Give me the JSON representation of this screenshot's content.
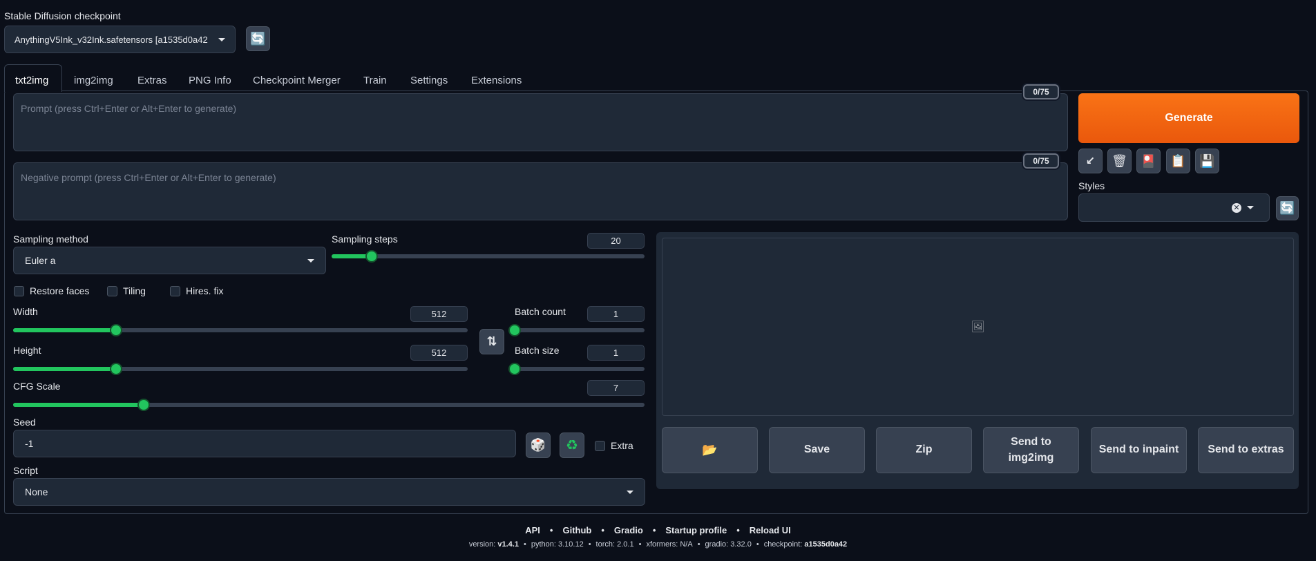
{
  "checkpoint": {
    "label": "Stable Diffusion checkpoint",
    "value": "AnythingV5Ink_v32Ink.safetensors [a1535d0a42"
  },
  "tabs": [
    "txt2img",
    "img2img",
    "Extras",
    "PNG Info",
    "Checkpoint Merger",
    "Train",
    "Settings",
    "Extensions"
  ],
  "prompt": {
    "placeholder": "Prompt (press Ctrl+Enter or Alt+Enter to generate)",
    "counter": "0/75"
  },
  "negative_prompt": {
    "placeholder": "Negative prompt (press Ctrl+Enter or Alt+Enter to generate)",
    "counter": "0/75"
  },
  "generate_label": "Generate",
  "tool_icons": {
    "read": "↙",
    "trash": "🗑",
    "style": "🎴",
    "clipboard": "📋",
    "save": "💾",
    "refresh": "🔄"
  },
  "styles_label": "Styles",
  "sampling": {
    "method_label": "Sampling method",
    "method_value": "Euler a",
    "steps_label": "Sampling steps",
    "steps_value": "20",
    "steps_min": 1,
    "steps_max": 150
  },
  "checkboxes": {
    "restore_faces": "Restore faces",
    "tiling": "Tiling",
    "hires_fix": "Hires. fix"
  },
  "width": {
    "label": "Width",
    "value": "512",
    "min": 64,
    "max": 2048
  },
  "height": {
    "label": "Height",
    "value": "512",
    "min": 64,
    "max": 2048
  },
  "batch_count": {
    "label": "Batch count",
    "value": "1",
    "min": 1,
    "max": 100
  },
  "batch_size": {
    "label": "Batch size",
    "value": "1",
    "min": 1,
    "max": 8
  },
  "cfg": {
    "label": "CFG Scale",
    "value": "7",
    "min": 1,
    "max": 30
  },
  "swap_icon": "⇅",
  "seed": {
    "label": "Seed",
    "value": "-1",
    "dice_icon": "🎲",
    "recycle_icon": "♻",
    "extra_label": "Extra"
  },
  "script": {
    "label": "Script",
    "value": "None"
  },
  "gallery_icon": "🖼",
  "output_buttons": {
    "folder": "📂",
    "save": "Save",
    "zip": "Zip",
    "img2img": "Send to img2img",
    "inpaint": "Send to inpaint",
    "extras": "Send to extras"
  },
  "footer": {
    "links": [
      "API",
      "Github",
      "Gradio",
      "Startup profile",
      "Reload UI"
    ],
    "sep": "•",
    "version_label": "version: ",
    "version": "v1.4.1",
    "python": "python: 3.10.12",
    "torch": "torch: 2.0.1",
    "xformers": "xformers: N/A",
    "gradio": "gradio: 3.32.0",
    "checkpoint_label": "checkpoint: ",
    "checkpoint": "a1535d0a42"
  },
  "colors": {
    "accent": "#ea580c",
    "slider": "#22c55e",
    "background": "#0b0f19"
  }
}
